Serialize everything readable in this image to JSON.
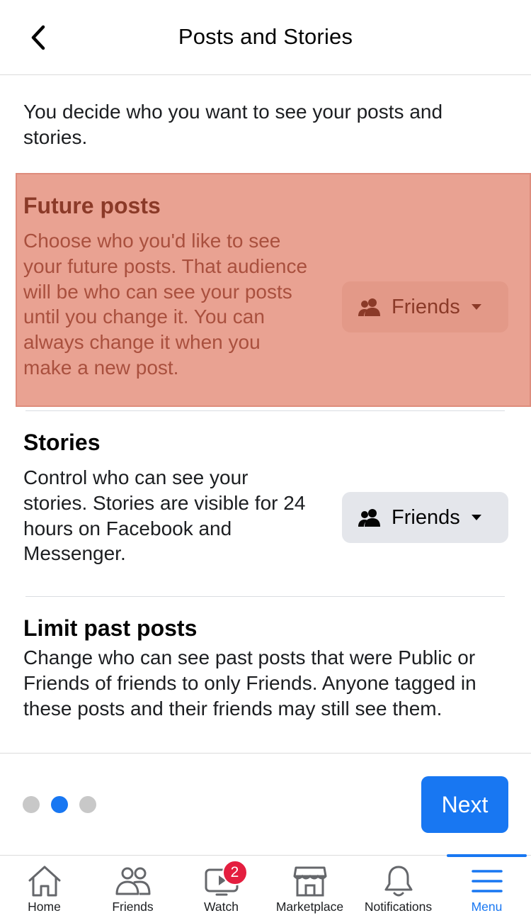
{
  "header": {
    "title": "Posts and Stories",
    "back_icon": "chevron-left-icon"
  },
  "intro": "You decide who you want to see your posts and stories.",
  "sections": {
    "future_posts": {
      "title": "Future posts",
      "description": "Choose who you'd like to see your future posts. That audience will be who can see your posts until you change it. You can always change it when you make a new post.",
      "audience": "Friends",
      "highlighted": true,
      "highlight_color": "#e9a292"
    },
    "stories": {
      "title": "Stories",
      "description": "Control who can see your stories. Stories are visible for 24 hours on Facebook and Messenger.",
      "audience": "Friends"
    },
    "limit_past_posts": {
      "title": "Limit past posts",
      "description": "Change who can see past posts that were Public or Friends of friends to only Friends. Anyone tagged in these posts and their friends may still see them."
    }
  },
  "pager": {
    "total": 3,
    "active_index": 1,
    "next_label": "Next"
  },
  "tabbar": {
    "items": [
      {
        "label": "Home",
        "icon": "home-icon"
      },
      {
        "label": "Friends",
        "icon": "friends-icon"
      },
      {
        "label": "Watch",
        "icon": "watch-icon",
        "badge": "2"
      },
      {
        "label": "Marketplace",
        "icon": "marketplace-icon"
      },
      {
        "label": "Notifications",
        "icon": "bell-icon"
      },
      {
        "label": "Menu",
        "icon": "menu-icon",
        "active": true
      }
    ]
  },
  "colors": {
    "accent": "#1877f2",
    "badge": "#e41e3f",
    "neutral_button": "#e4e6eb"
  }
}
